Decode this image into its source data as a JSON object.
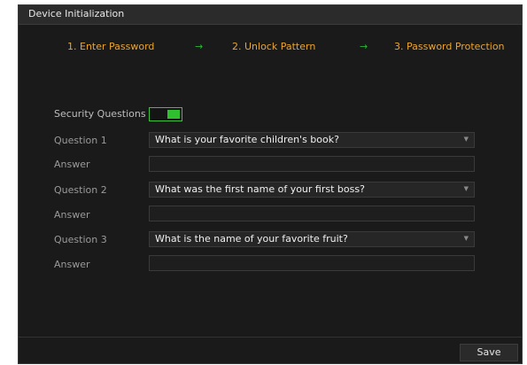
{
  "window": {
    "title": "Device Initialization"
  },
  "steps": [
    {
      "label": "1.  Enter Password"
    },
    {
      "label": "2.  Unlock Pattern"
    },
    {
      "label": "3.  Password Protection"
    }
  ],
  "step_arrow": "→",
  "form": {
    "security_questions_label": "Security Questions",
    "security_questions_enabled": true,
    "rows": [
      {
        "question_label": "Question 1",
        "question_value": "What is your favorite children's book?",
        "answer_label": "Answer",
        "answer_value": ""
      },
      {
        "question_label": "Question 2",
        "question_value": "What was the first name of your first boss?",
        "answer_label": "Answer",
        "answer_value": ""
      },
      {
        "question_label": "Question 3",
        "question_value": "What is the name of your favorite fruit?",
        "answer_label": "Answer",
        "answer_value": ""
      }
    ]
  },
  "footer": {
    "save_label": "Save"
  },
  "colors": {
    "background": "#1a1a1a",
    "step_text": "#e8a531",
    "step_arrow": "#2fb53a",
    "toggle_on": "#2fbf2f"
  },
  "icons": {
    "dropdown": "caret-down-icon",
    "step_separator": "arrow-right-icon"
  }
}
